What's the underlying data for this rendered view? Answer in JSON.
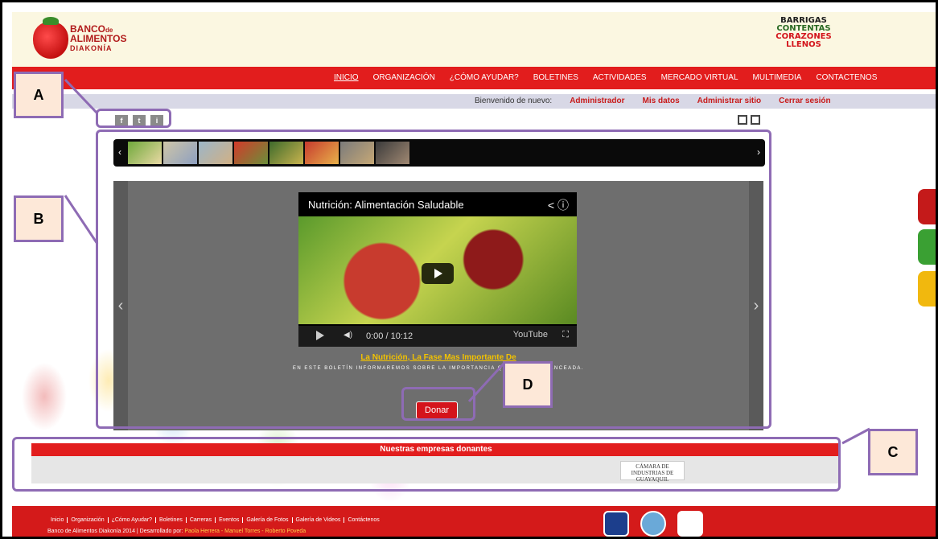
{
  "header": {
    "logo_main": "BANCO",
    "logo_sub1": "de",
    "logo_sub2": "ALIMENTOS",
    "logo_org": "DIAKONÍA",
    "slogan": [
      "BARRIGAS",
      "CONTENTAS",
      "CORAZONES",
      "LLENOS"
    ]
  },
  "nav": {
    "items": [
      "INICIO",
      "ORGANIZACIÓN",
      "¿CÓMO AYUDAR?",
      "BOLETINES",
      "ACTIVIDADES",
      "MERCADO VIRTUAL",
      "MULTIMEDIA",
      "CONTACTENOS"
    ]
  },
  "welcome": {
    "label": "Bienvenido de nuevo:",
    "user": "Administrador",
    "my_data": "Mis datos",
    "admin": "Administrar sitio",
    "logout": "Cerrar sesión"
  },
  "social": [
    "f",
    "t",
    "i"
  ],
  "slide": {
    "video_title": "Nutrición: Alimentación Saludable",
    "time": "0:00 / 10:12",
    "youtube_label": "YouTube",
    "title": "La Nutrición, La Fase Mas Importante De",
    "desc": "EN ESTE BOLETÍN INFORMAREMOS SOBRE LA IMPORTANCIA QUE TIENE                BALANCEADA.",
    "donate": "Donar"
  },
  "donors": {
    "heading": "Nuestras empresas donantes",
    "logo_text": "CÁMARA DE INDUSTRIAS DE GUAYAQUIL"
  },
  "footer": {
    "links": [
      "Inicio",
      "Organización",
      "¿Cómo Ayudar?",
      "Boletines",
      "Carreras",
      "Eventos",
      "Galería de Fotos",
      "Galería de Videos",
      "Contáctenos"
    ],
    "credit_prefix": "Banco de Alimentos Diakonía 2014 | Desarrollado por:",
    "credit_names": "Paola Herrera - Manuel Torres - Roberto Poveda"
  },
  "annotations": {
    "a": "A",
    "b": "B",
    "c": "C",
    "d": "D"
  },
  "colors": {
    "nav_red": "#e21d1d",
    "annotation_purple": "#8e6bb4",
    "annotation_fill": "#fde8d8",
    "header_cream": "#fbf7e1"
  }
}
